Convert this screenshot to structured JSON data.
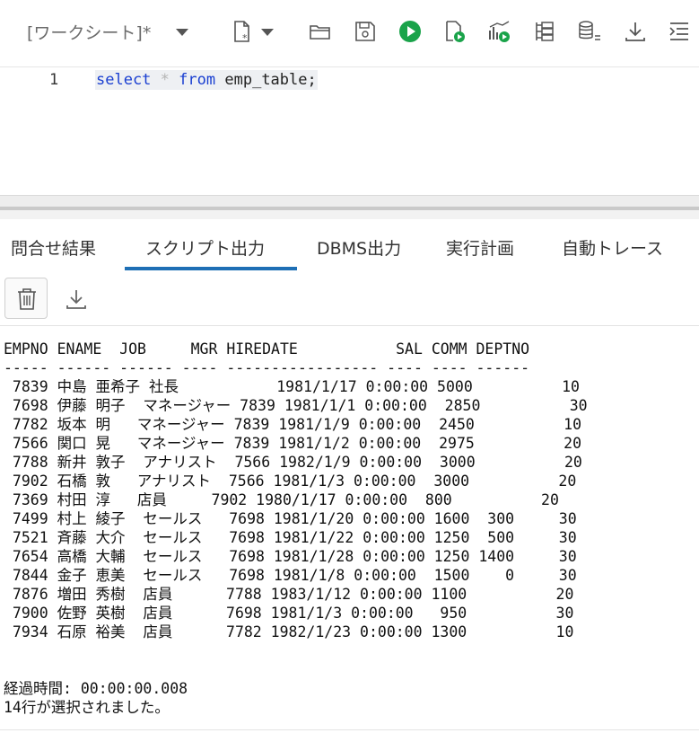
{
  "toolbar": {
    "worksheet_label": "[ワークシート]*",
    "icons": [
      "new-worksheet-icon",
      "open-folder-icon",
      "save-icon",
      "run-statement-icon",
      "run-script-icon",
      "explain-plan-icon",
      "autotrace-icon",
      "sql-history-icon",
      "download-icon",
      "format-icon"
    ],
    "accent_color": "#1aa34a"
  },
  "editor": {
    "line_number": "1",
    "code": {
      "kw_select": "select",
      "star": "*",
      "kw_from": "from",
      "rest": "emp_table;"
    }
  },
  "tabs": [
    {
      "label": "問合せ結果",
      "active": false
    },
    {
      "label": "スクリプト出力",
      "active": true
    },
    {
      "label": "DBMS出力",
      "active": false
    },
    {
      "label": "実行計画",
      "active": false
    },
    {
      "label": "自動トレース",
      "active": false
    }
  ],
  "output": {
    "header": "EMPNO ENAME  JOB     MGR HIREDATE           SAL COMM DEPTNO",
    "separator": "----- ------ ------ ---- ----------------- ---- ---- ------",
    "rows": [
      " 7839 中島 亜希子 社長           1981/1/17 0:00:00 5000          10",
      " 7698 伊藤 明子  マネージャー 7839 1981/1/1 0:00:00  2850          30",
      " 7782 坂本 明   マネージャー 7839 1981/1/9 0:00:00  2450          10",
      " 7566 関口 晃   マネージャー 7839 1981/1/2 0:00:00  2975          20",
      " 7788 新井 敦子  アナリスト  7566 1982/1/9 0:00:00  3000          20",
      " 7902 石橋 敦   アナリスト  7566 1981/1/3 0:00:00  3000          20",
      " 7369 村田 淳   店員     7902 1980/1/17 0:00:00  800          20",
      " 7499 村上 綾子  セールス   7698 1981/1/20 0:00:00 1600  300     30",
      " 7521 斉藤 大介  セールス   7698 1981/1/22 0:00:00 1250  500     30",
      " 7654 高橋 大輔  セールス   7698 1981/1/28 0:00:00 1250 1400     30",
      " 7844 金子 恵美  セールス   7698 1981/1/8 0:00:00  1500    0     30",
      " 7876 増田 秀樹  店員      7788 1983/1/12 0:00:00 1100          20",
      " 7900 佐野 英樹  店員      7698 1981/1/3 0:00:00   950          30",
      " 7934 石原 裕美  店員      7782 1982/1/23 0:00:00 1300          10"
    ],
    "elapsed": "経過時間: 00:00:00.008",
    "rows_selected": "14行が選択されました。"
  }
}
